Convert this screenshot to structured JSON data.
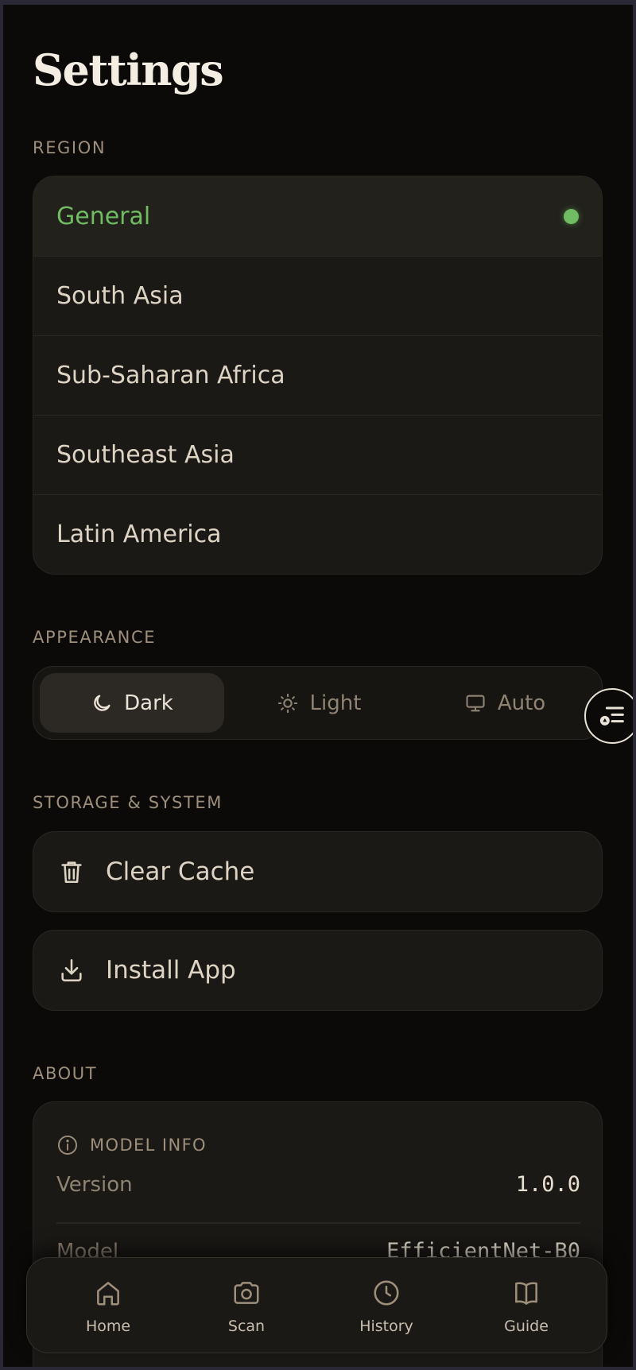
{
  "page": {
    "title": "Settings"
  },
  "region": {
    "label": "REGION",
    "items": [
      {
        "label": "General",
        "active": true
      },
      {
        "label": "South Asia",
        "active": false
      },
      {
        "label": "Sub-Saharan Africa",
        "active": false
      },
      {
        "label": "Southeast Asia",
        "active": false
      },
      {
        "label": "Latin America",
        "active": false
      }
    ]
  },
  "appearance": {
    "label": "APPEARANCE",
    "options": [
      {
        "label": "Dark",
        "icon": "moon-icon",
        "active": true
      },
      {
        "label": "Light",
        "icon": "sun-icon",
        "active": false
      },
      {
        "label": "Auto",
        "icon": "monitor-icon",
        "active": false
      }
    ]
  },
  "storage": {
    "label": "STORAGE & SYSTEM",
    "clear_cache": {
      "label": "Clear Cache",
      "icon": "trash-icon"
    },
    "install_app": {
      "label": "Install App",
      "icon": "download-icon"
    }
  },
  "about": {
    "label": "ABOUT",
    "model_info": {
      "heading": "MODEL INFO",
      "icon": "info-icon",
      "rows": [
        {
          "key": "Version",
          "value": "1.0.0"
        },
        {
          "key": "Model",
          "value": "EfficientNet-B0"
        }
      ]
    }
  },
  "fab": {
    "icon": "filter-list-icon"
  },
  "nav": {
    "items": [
      {
        "label": "Home",
        "icon": "home-icon"
      },
      {
        "label": "Scan",
        "icon": "camera-icon"
      },
      {
        "label": "History",
        "icon": "clock-icon"
      },
      {
        "label": "Guide",
        "icon": "book-icon"
      }
    ]
  },
  "colors": {
    "background": "#0b0a09",
    "card": "#1b1916",
    "accent_green": "#6fbc62",
    "text": "#ddd4c4",
    "muted": "#9e8f7b"
  }
}
